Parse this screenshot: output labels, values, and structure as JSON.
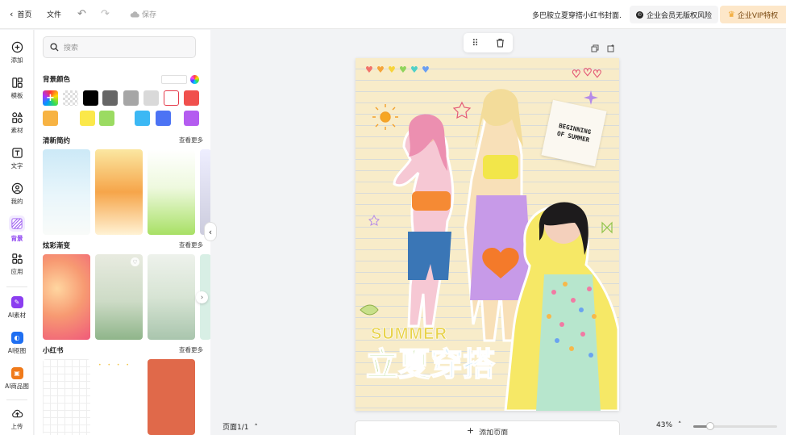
{
  "topbar": {
    "home_label": "首页",
    "file_label": "文件",
    "save_label": "保存",
    "title": "多巴胺立夏穿搭小红书封面.",
    "enterprise_label": "企业会员无版权风险",
    "vip_label": "企业VIP特权"
  },
  "rail": {
    "items": [
      {
        "label": "添加",
        "icon": "plus-circle-icon"
      },
      {
        "label": "模板",
        "icon": "template-icon"
      },
      {
        "label": "素材",
        "icon": "elements-icon"
      },
      {
        "label": "文字",
        "icon": "text-icon"
      },
      {
        "label": "我的",
        "icon": "user-icon"
      },
      {
        "label": "背景",
        "icon": "background-icon"
      },
      {
        "label": "应用",
        "icon": "apps-icon"
      },
      {
        "label": "AI素材",
        "icon": "ai-material-icon"
      },
      {
        "label": "AI抠图",
        "icon": "ai-cutout-icon"
      },
      {
        "label": "AI商品图",
        "icon": "ai-product-icon"
      },
      {
        "label": "上传",
        "icon": "upload-icon"
      }
    ],
    "active": "背景"
  },
  "panel": {
    "search_placeholder": "搜索",
    "bg_color_title": "背景颜色",
    "swatches": [
      "#000000",
      "#666666",
      "#a6a6a6",
      "#d9d9d9",
      "#ffffff",
      "#f0504d",
      "#f7b343",
      "#fbe84a",
      "#9bdb62",
      "#3cb8f4",
      "#4c73f4",
      "#b45cf0"
    ],
    "sections": [
      {
        "title": "清新简约",
        "more": "查看更多"
      },
      {
        "title": "炫彩渐变",
        "more": "查看更多"
      },
      {
        "title": "小红书",
        "more": "查看更多"
      }
    ]
  },
  "poster": {
    "note_line1": "BEGINNING",
    "note_line2": "OF SUMMER",
    "summer_text": "SUMMER",
    "title_part1": "立夏",
    "title_part2": "穿搭"
  },
  "footer": {
    "page_label": "页面1/1",
    "add_page_label": "添加页面",
    "zoom_label": "43%",
    "zoom_fraction": 0.2
  }
}
